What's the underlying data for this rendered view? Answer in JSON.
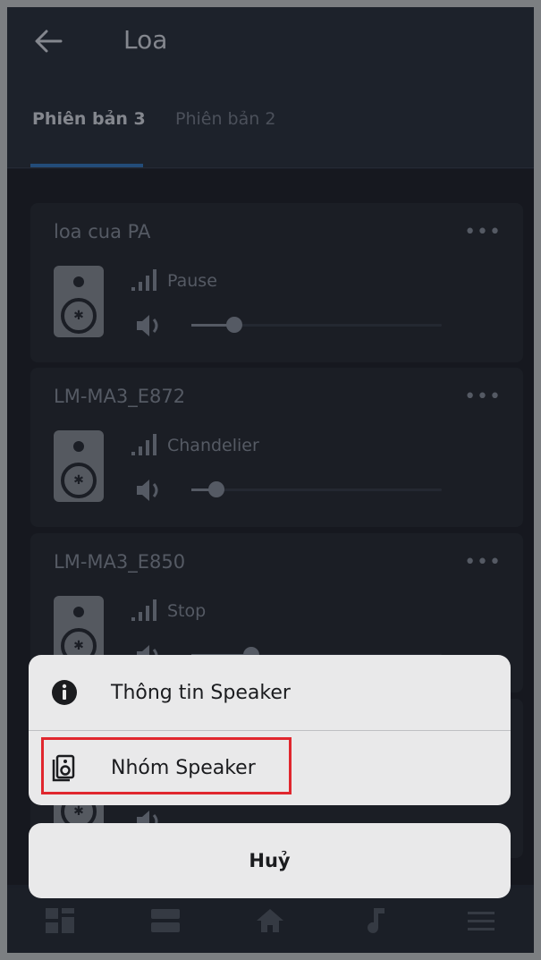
{
  "header": {
    "title": "Loa",
    "tabs": [
      {
        "label": "Phiên bản 3",
        "active": true
      },
      {
        "label": "Phiên bản 2",
        "active": false
      }
    ]
  },
  "speakers": [
    {
      "name": "loa cua PA",
      "more": "•••",
      "status": "Pause",
      "volume": 0.17
    },
    {
      "name": "LM-MA3_E872",
      "more": "•••",
      "status": "Chandelier",
      "volume": 0.1
    },
    {
      "name": "LM-MA3_E850",
      "more": "•••",
      "status": "Stop",
      "volume": 0.24
    }
  ],
  "action_sheet": {
    "items": [
      {
        "label": "Thông tin Speaker",
        "icon": "info-icon"
      },
      {
        "label": "Nhóm Speaker",
        "icon": "speaker-group-icon",
        "highlighted": true
      }
    ],
    "cancel_label": "Huỷ"
  },
  "bottom_nav": [
    "dashboard-icon",
    "list-icon",
    "home-icon",
    "music-icon",
    "menu-icon"
  ],
  "colors": {
    "accent": "#2c6fb3",
    "highlight": "#e0272e"
  }
}
